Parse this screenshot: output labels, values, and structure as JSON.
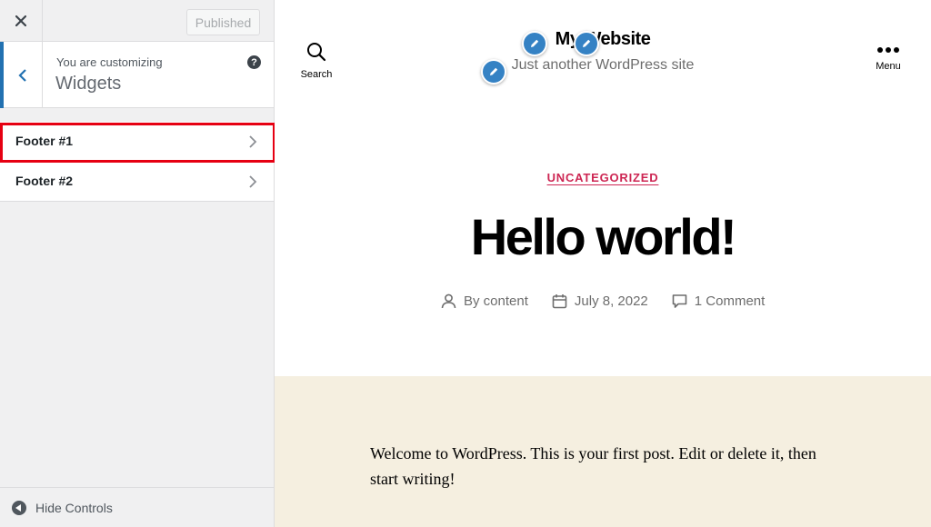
{
  "sidebar": {
    "publish_label": "Published",
    "customizing_label": "You are customizing",
    "section_name": "Widgets",
    "help_glyph": "?",
    "items": [
      {
        "label": "Footer #1",
        "highlighted": true
      },
      {
        "label": "Footer #2",
        "highlighted": false
      }
    ],
    "hide_controls_label": "Hide Controls",
    "accent_color": "#2271b1",
    "highlight_color": "#e60012"
  },
  "preview": {
    "search_label": "Search",
    "menu_label": "Menu",
    "site_title": "My Website",
    "site_description": "Just another WordPress site",
    "category": "UNCATEGORIZED",
    "post_title": "Hello world!",
    "meta": {
      "author": "By content",
      "date": "July 8, 2022",
      "comments": "1 Comment"
    },
    "post_excerpt": "Welcome to WordPress. This is your first post. Edit or delete it, then start writing!",
    "accent_color": "#cd2653",
    "band_color": "#f5efe0"
  }
}
